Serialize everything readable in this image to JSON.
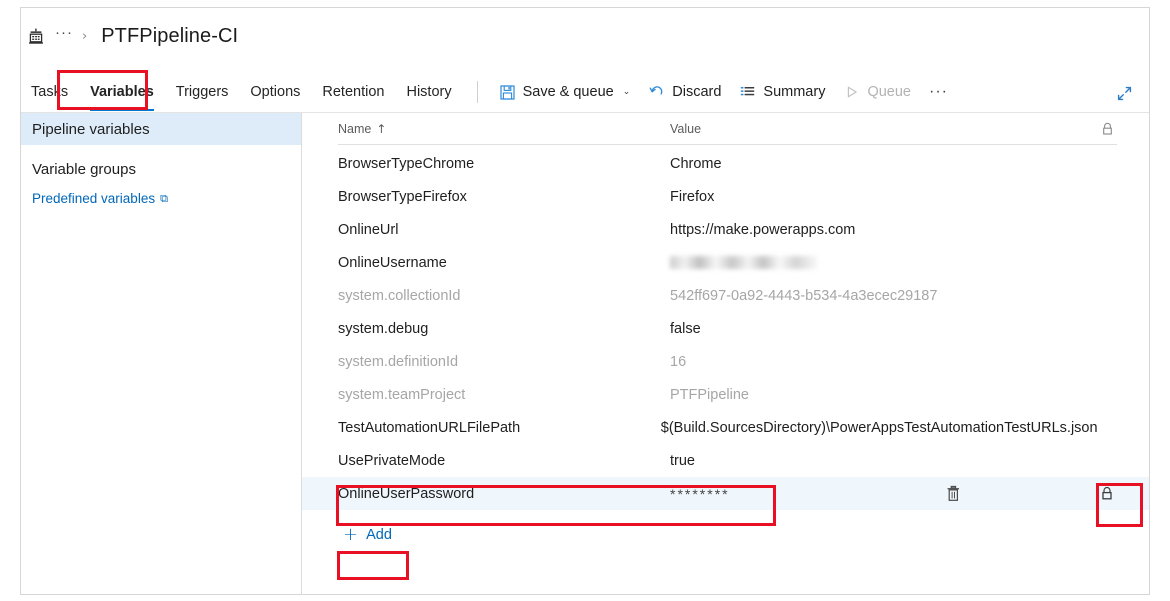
{
  "breadcrumb": {
    "icon": "pipeline-build-icon",
    "ellipsis": "···",
    "separator": "›",
    "title": "PTFPipeline-CI"
  },
  "tabs": [
    {
      "label": "Tasks",
      "active": false
    },
    {
      "label": "Variables",
      "active": true
    },
    {
      "label": "Triggers",
      "active": false
    },
    {
      "label": "Options",
      "active": false
    },
    {
      "label": "Retention",
      "active": false
    },
    {
      "label": "History",
      "active": false
    }
  ],
  "toolbar": {
    "save_queue_label": "Save & queue",
    "save_queue_caret": "⌄",
    "discard_label": "Discard",
    "summary_label": "Summary",
    "queue_label": "Queue",
    "overflow_label": "···",
    "expand_label": "expand-icon"
  },
  "sidebar": {
    "items": [
      {
        "label": "Pipeline variables",
        "selected": true
      },
      {
        "label": "Variable groups",
        "selected": false
      }
    ],
    "link": {
      "label": "Predefined variables",
      "external_glyph": "⧉"
    }
  },
  "grid": {
    "columns": {
      "name": "Name",
      "sort_glyph": "↑",
      "value": "Value",
      "lock": "lock-icon"
    },
    "rows": [
      {
        "name": "BrowserTypeChrome",
        "value": "Chrome",
        "dim": false,
        "kind": "text"
      },
      {
        "name": "BrowserTypeFirefox",
        "value": "Firefox",
        "dim": false,
        "kind": "text"
      },
      {
        "name": "OnlineUrl",
        "value": "https://make.powerapps.com",
        "dim": false,
        "kind": "text"
      },
      {
        "name": "OnlineUsername",
        "value": "",
        "dim": false,
        "kind": "blurred"
      },
      {
        "name": "system.collectionId",
        "value": "542ff697-0a92-4443-b534-4a3ecec29187",
        "dim": true,
        "kind": "text"
      },
      {
        "name": "system.debug",
        "value": "false",
        "dim": false,
        "kind": "text"
      },
      {
        "name": "system.definitionId",
        "value": "16",
        "dim": true,
        "kind": "text"
      },
      {
        "name": "system.teamProject",
        "value": "PTFPipeline",
        "dim": true,
        "kind": "text"
      },
      {
        "name": "TestAutomationURLFilePath",
        "value": "$(Build.SourcesDirectory)\\PowerAppsTestAutomationTestURLs.json",
        "dim": false,
        "kind": "text"
      },
      {
        "name": "UsePrivateMode",
        "value": "true",
        "dim": false,
        "kind": "text"
      },
      {
        "name": "OnlineUserPassword",
        "value": "********",
        "dim": false,
        "kind": "secret",
        "highlighted": true,
        "locked": true,
        "delete_icon": "trash-icon"
      }
    ],
    "add_button": {
      "glyph": "+",
      "label": "Add"
    }
  },
  "annotations": {
    "color": "#e81123",
    "boxes": [
      "variables-tab",
      "online-user-password-row",
      "password-lock-toggle",
      "add-variable-button"
    ]
  },
  "theme": {
    "accent": "#0078d4",
    "link": "#0067b8",
    "selected_row_bg": "#deecf9",
    "highlight_row_bg": "#eff6fc",
    "disabled_text": "#a6a6a6"
  }
}
